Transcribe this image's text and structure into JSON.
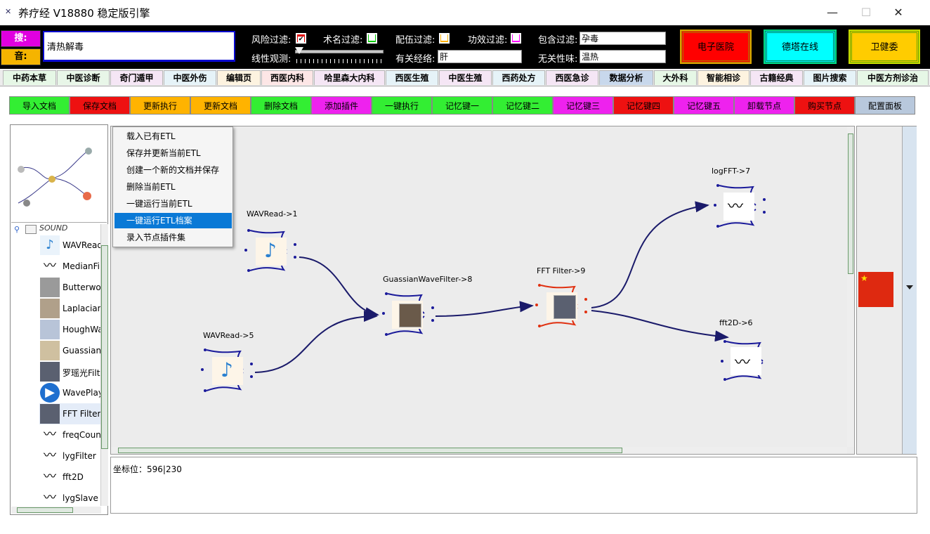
{
  "window": {
    "title": "养疗经 V18880 稳定版引擎",
    "icon": "app-x-icon",
    "controls": {
      "minimize": "—",
      "maximize": "☐",
      "close": "✕"
    }
  },
  "search": {
    "search_label": "搜:",
    "sound_label": "音:",
    "value": "清热解毒"
  },
  "filters": {
    "risk": {
      "label": "风险过滤:",
      "checked": true,
      "color": "#e00000"
    },
    "term": {
      "label": "术名过滤:",
      "checked": false,
      "color": "#00cc00"
    },
    "compat": {
      "label": "配伍过滤:",
      "checked": false,
      "color": "#ffb000"
    },
    "effect": {
      "label": "功效过滤:",
      "checked": false,
      "color": "#ff00ff"
    },
    "contains": {
      "label": "包含过滤:",
      "value": "孕毒"
    },
    "linear": {
      "label": "线性观测:"
    },
    "meridian": {
      "label": "有关经络:",
      "value": "肝"
    },
    "nature": {
      "label": "无关性味:",
      "value": "温热"
    }
  },
  "top_buttons": {
    "hospital": "电子医院",
    "online": "德塔在线",
    "health": "卫健委"
  },
  "tabs": [
    "中药本草",
    "中医诊断",
    "奇门遁甲",
    "中医外伤",
    "编辑页",
    "西医内科",
    "哈里森大内科",
    "西医生殖",
    "中医生殖",
    "西药处方",
    "西医急诊",
    "数据分析",
    "大外科",
    "智能相诊",
    "古籍经典",
    "图片搜索",
    "中医方剂诊治"
  ],
  "active_tab": "数据分析",
  "toolbar": [
    "导入文档",
    "保存文档",
    "更新执行",
    "更新文档",
    "删除文档",
    "添加插件",
    "一键执行",
    "记忆键一",
    "记忆键二",
    "记忆键三",
    "记忆键四",
    "记忆键五",
    "卸载节点",
    "购买节点",
    "配置面板"
  ],
  "tree": {
    "root": "SOUND",
    "items": [
      "WAVRead",
      "MedianFil",
      "Butterwor",
      "Laplacian",
      "HoughWa",
      "Guassian",
      "罗瑶光Filt",
      "WavePlay",
      "FFT Filter",
      "freqCoun",
      "lygFilter",
      "fft2D",
      "lygSlave"
    ],
    "selected": "FFT Filter"
  },
  "context_menu": {
    "items": [
      "载入已有ETL",
      "保存并更新当前ETL",
      "创建一个新的文档并保存",
      "删除当前ETL",
      "一键运行当前ETL",
      "一键运行ETL档案",
      "录入节点插件集"
    ],
    "highlighted": "一键运行ETL档案"
  },
  "nodes": [
    {
      "label": "WAVRead->1",
      "icon": "music-note-icon"
    },
    {
      "label": "WAVRead->5",
      "icon": "music-note-icon"
    },
    {
      "label": "GuassianWaveFilter->8",
      "icon": "portrait-icon"
    },
    {
      "label": "FFT Filter->9",
      "icon": "portrait-icon"
    },
    {
      "label": "logFFT->7",
      "icon": "waveform-icon"
    },
    {
      "label": "fft2D->6",
      "icon": "waveform-icon"
    }
  ],
  "console": {
    "text": "坐标位：596|230"
  },
  "right_panel": {
    "flag": "china-flag-icon"
  }
}
